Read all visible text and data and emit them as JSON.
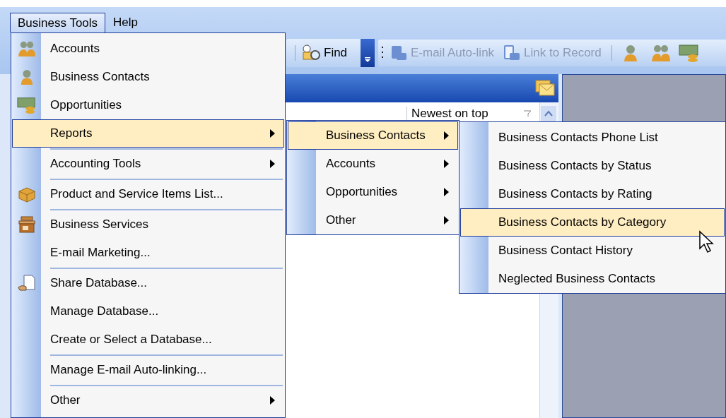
{
  "menu_bar": [
    {
      "label": "Business Tools",
      "selected": true
    },
    {
      "label": "Help",
      "selected": false
    }
  ],
  "toolbar": {
    "find": {
      "label": "Find"
    },
    "email_auto_link": {
      "label": "E-mail Auto-link",
      "disabled": true
    },
    "link_to_record": {
      "label": "Link to Record",
      "disabled": true
    }
  },
  "list_header": {
    "sort": "Newest on top"
  },
  "menu": {
    "items": [
      {
        "label": "Accounts",
        "submenu": false,
        "selected": false,
        "separator_before": false
      },
      {
        "label": "Business Contacts",
        "submenu": false,
        "selected": false,
        "separator_before": false
      },
      {
        "label": "Opportunities",
        "submenu": false,
        "selected": false,
        "separator_before": false
      },
      {
        "label": "Reports",
        "submenu": true,
        "selected": true,
        "separator_before": false
      },
      {
        "label": "Accounting Tools",
        "submenu": true,
        "selected": false,
        "separator_before": true
      },
      {
        "label": "Product and Service Items List...",
        "submenu": false,
        "selected": false,
        "separator_before": true
      },
      {
        "label": "Business Services",
        "submenu": false,
        "selected": false,
        "separator_before": true
      },
      {
        "label": "E-mail Marketing...",
        "submenu": false,
        "selected": false,
        "separator_before": false
      },
      {
        "label": "Share Database...",
        "submenu": false,
        "selected": false,
        "separator_before": true
      },
      {
        "label": "Manage Database...",
        "submenu": false,
        "selected": false,
        "separator_before": false
      },
      {
        "label": "Create or Select a Database...",
        "submenu": false,
        "selected": false,
        "separator_before": false
      },
      {
        "label": "Manage E-mail Auto-linking...",
        "submenu": false,
        "selected": false,
        "separator_before": true
      },
      {
        "label": "Other",
        "submenu": true,
        "selected": false,
        "separator_before": true
      }
    ]
  },
  "reports_submenu": {
    "items": [
      {
        "label": "Business Contacts",
        "submenu": true,
        "selected": true
      },
      {
        "label": "Accounts",
        "submenu": true,
        "selected": false
      },
      {
        "label": "Opportunities",
        "submenu": true,
        "selected": false
      },
      {
        "label": "Other",
        "submenu": true,
        "selected": false
      }
    ]
  },
  "business_contacts_submenu": {
    "items": [
      {
        "label": "Business Contacts Phone List",
        "selected": false
      },
      {
        "label": "Business Contacts by Status",
        "selected": false
      },
      {
        "label": "Business Contacts by Rating",
        "selected": false
      },
      {
        "label": "Business Contacts by Category",
        "selected": true
      },
      {
        "label": "Business Contact History",
        "selected": false
      },
      {
        "label": "Neglected Business Contacts",
        "selected": false
      }
    ]
  }
}
